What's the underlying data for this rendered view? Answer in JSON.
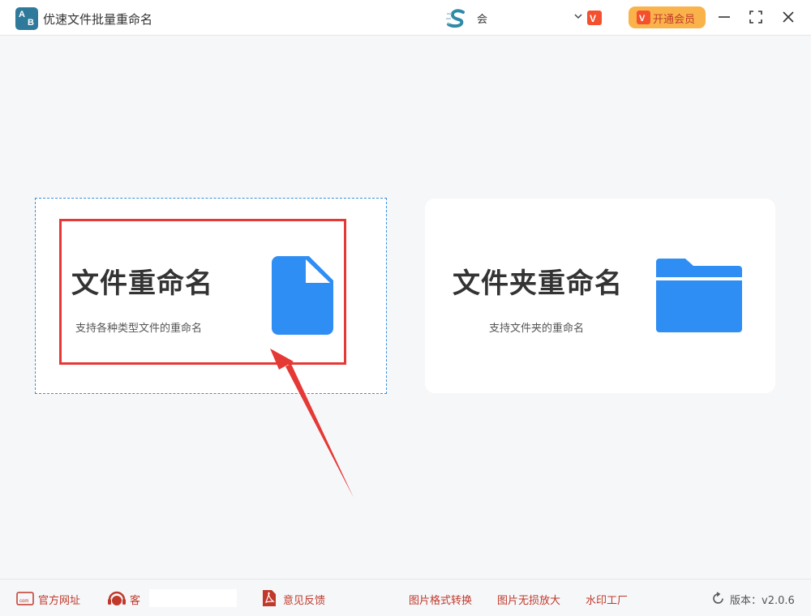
{
  "titlebar": {
    "app_title": "优速文件批量重命名",
    "logo_text_a": "A",
    "logo_text_b": "B",
    "user_name": "会",
    "vip_label": "开通会员"
  },
  "cards": {
    "file": {
      "title": "文件重命名",
      "desc": "支持各种类型文件的重命名"
    },
    "folder": {
      "title": "文件夹重命名",
      "desc": "支持文件夹的重命名"
    }
  },
  "footer": {
    "website": "官方网址",
    "service": "客",
    "feedback": "意见反馈",
    "format_convert": "图片格式转换",
    "lossless_enlarge": "图片无损放大",
    "watermark": "水印工厂",
    "version": "版本：v2.0.6"
  },
  "colors": {
    "accent_blue": "#2f8ef4",
    "highlight_red": "#e53935",
    "vip_orange": "#f9b34a",
    "footer_red": "#c0392b"
  },
  "icons": {
    "app": "app-logo-icon",
    "file": "file-icon",
    "folder": "folder-icon",
    "minimize": "minimize-icon",
    "maximize": "maximize-icon",
    "close": "close-icon",
    "refresh": "refresh-icon",
    "pdf": "pdf-icon",
    "headset": "headset-icon",
    "web": "web-icon"
  }
}
